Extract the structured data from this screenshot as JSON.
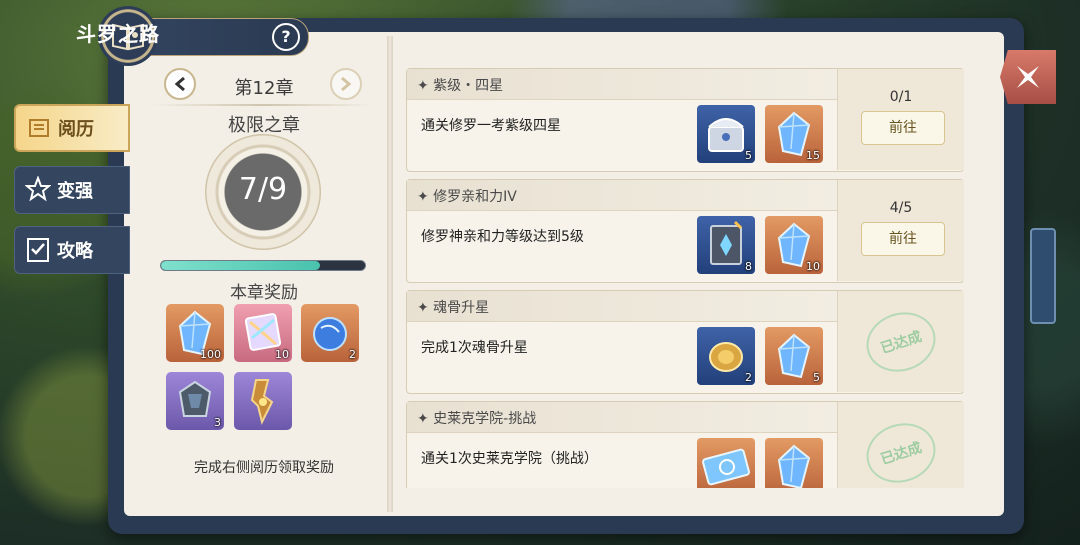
{
  "header": {
    "title": "斗罗之路",
    "help_glyph": "?"
  },
  "sidebar": {
    "tabs": [
      {
        "label": "阅历",
        "icon": "scroll-icon",
        "active": true
      },
      {
        "label": "变强",
        "icon": "star-arrow-icon",
        "active": false
      },
      {
        "label": "攻略",
        "icon": "checklist-icon",
        "active": false
      }
    ]
  },
  "chapter": {
    "title": "第12章",
    "subtitle": "极限之章",
    "progress_text": "7/9",
    "progress_fraction": 0.78,
    "rewards_title": "本章奖励",
    "rewards": [
      {
        "icon": "blue-crystal-icon",
        "count": "100",
        "bg": "bg-orange"
      },
      {
        "icon": "rainbow-prism-icon",
        "count": "10",
        "bg": "bg-pink"
      },
      {
        "icon": "blue-orb-icon",
        "count": "2",
        "bg": "bg-orange"
      },
      {
        "icon": "dark-gem-icon",
        "count": "3",
        "bg": "bg-purple"
      },
      {
        "icon": "golden-key-icon",
        "count": "",
        "bg": "bg-purple"
      }
    ],
    "reward_hint": "完成右侧阅历领取奖励"
  },
  "quests": [
    {
      "title": "紫级・四星",
      "desc": "通关修罗一考紫级四星",
      "progress": "0/1",
      "action": "前往",
      "done": false,
      "items": [
        {
          "icon": "silver-chest-icon",
          "count": "5",
          "bg": "bg-blue"
        },
        {
          "icon": "blue-crystal-icon",
          "count": "15",
          "bg": "bg-orange"
        }
      ]
    },
    {
      "title": "修罗亲和力IV",
      "desc": "修罗神亲和力等级达到5级",
      "progress": "4/5",
      "action": "前往",
      "done": false,
      "items": [
        {
          "icon": "rune-book-icon",
          "count": "8",
          "bg": "bg-blue"
        },
        {
          "icon": "blue-crystal-icon",
          "count": "10",
          "bg": "bg-orange"
        }
      ]
    },
    {
      "title": "魂骨升星",
      "desc": "完成1次魂骨升星",
      "progress": "",
      "action": "",
      "done": true,
      "stamp": "已达成",
      "items": [
        {
          "icon": "gold-coin-icon",
          "count": "2",
          "bg": "bg-blue"
        },
        {
          "icon": "blue-crystal-icon",
          "count": "5",
          "bg": "bg-orange"
        }
      ]
    },
    {
      "title": "史莱克学院-挑战",
      "desc": "通关1次史莱克学院（挑战）",
      "progress": "",
      "action": "",
      "done": true,
      "stamp": "已达成",
      "items": [
        {
          "icon": "ice-ticket-icon",
          "count": "",
          "bg": "bg-orange"
        },
        {
          "icon": "blue-crystal-icon",
          "count": "",
          "bg": "bg-orange"
        }
      ]
    }
  ],
  "colors": {
    "accent_gold": "#caa55a",
    "frame_navy": "#2a3a52",
    "progress_teal": "#49c2ad",
    "close_red": "#c05a4e",
    "stamp_green": "#9ccca0"
  }
}
